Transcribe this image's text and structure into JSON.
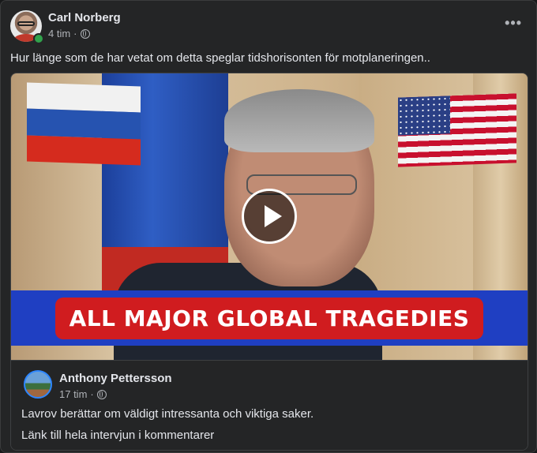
{
  "post": {
    "author": "Carl Norberg",
    "time": "4 tim",
    "separator": "·",
    "privacy_icon": "globe-icon",
    "more_icon": "more-options-icon",
    "more_label": "•••",
    "text": "Hur länge som de har vetat om detta speglar tidshorisonten för motplaneringen..",
    "online": true
  },
  "shared_post": {
    "video": {
      "banner_text": "ALL MAJOR GLOBAL TRAGEDIES",
      "play_icon": "play-icon"
    },
    "author": "Anthony Pettersson",
    "time": "17 tim",
    "separator": "·",
    "privacy_icon": "globe-icon",
    "text_line_1": "Lavrov berättar om väldigt intressanta och viktiga saker.",
    "text_line_2": "Länk till hela intervjun i kommentarer"
  },
  "colors": {
    "background": "#242526",
    "text_primary": "#e4e6eb",
    "text_secondary": "#b0b3b8",
    "online_dot": "#31a24c",
    "banner_blue": "#1f3fc2",
    "banner_red": "#d01c1f"
  }
}
